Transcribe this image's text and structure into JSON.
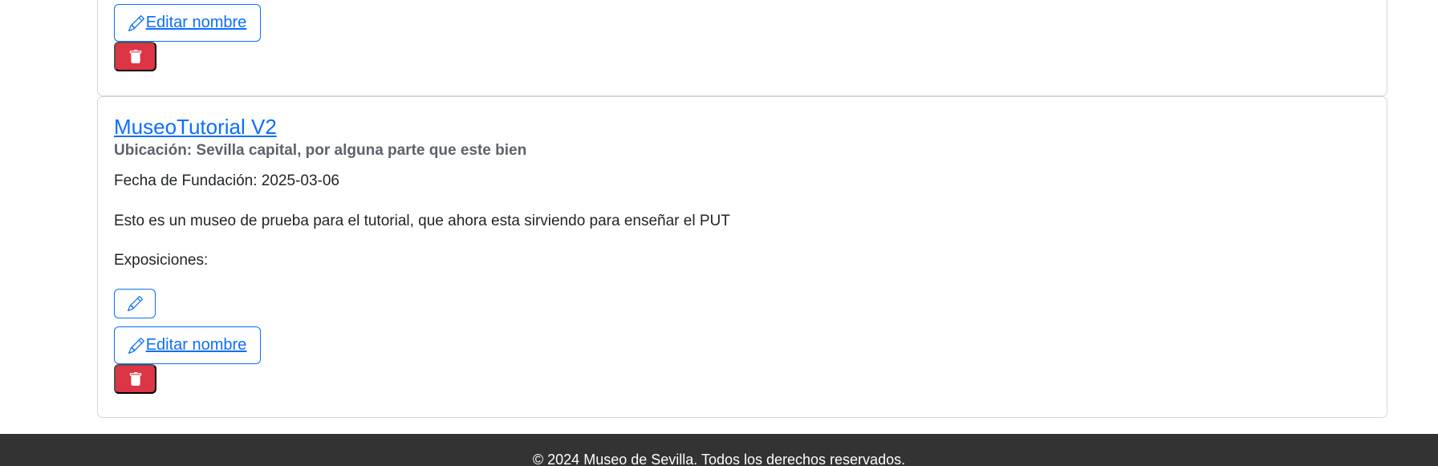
{
  "museums": [
    {
      "edit_name_label": "Editar nombre"
    },
    {
      "title": "MuseoTutorial V2",
      "location": "Ubicación: Sevilla capital, por alguna parte que este bien",
      "founding_date": "Fecha de Fundación: 2025-03-06",
      "description": "Esto es un museo de prueba para el tutorial, que ahora esta sirviendo para enseñar el PUT",
      "exhibitions_label": "Exposiciones:",
      "edit_name_label": "Editar nombre"
    }
  ],
  "footer": {
    "text": "© 2024 Museo de Sevilla. Todos los derechos reservados."
  },
  "icons": {
    "edit": "pencil-icon",
    "delete": "trash-icon"
  },
  "colors": {
    "primary": "#0d6efd",
    "danger": "#dc3545",
    "footer_bg": "#333333",
    "subtitle": "#5c636a"
  }
}
